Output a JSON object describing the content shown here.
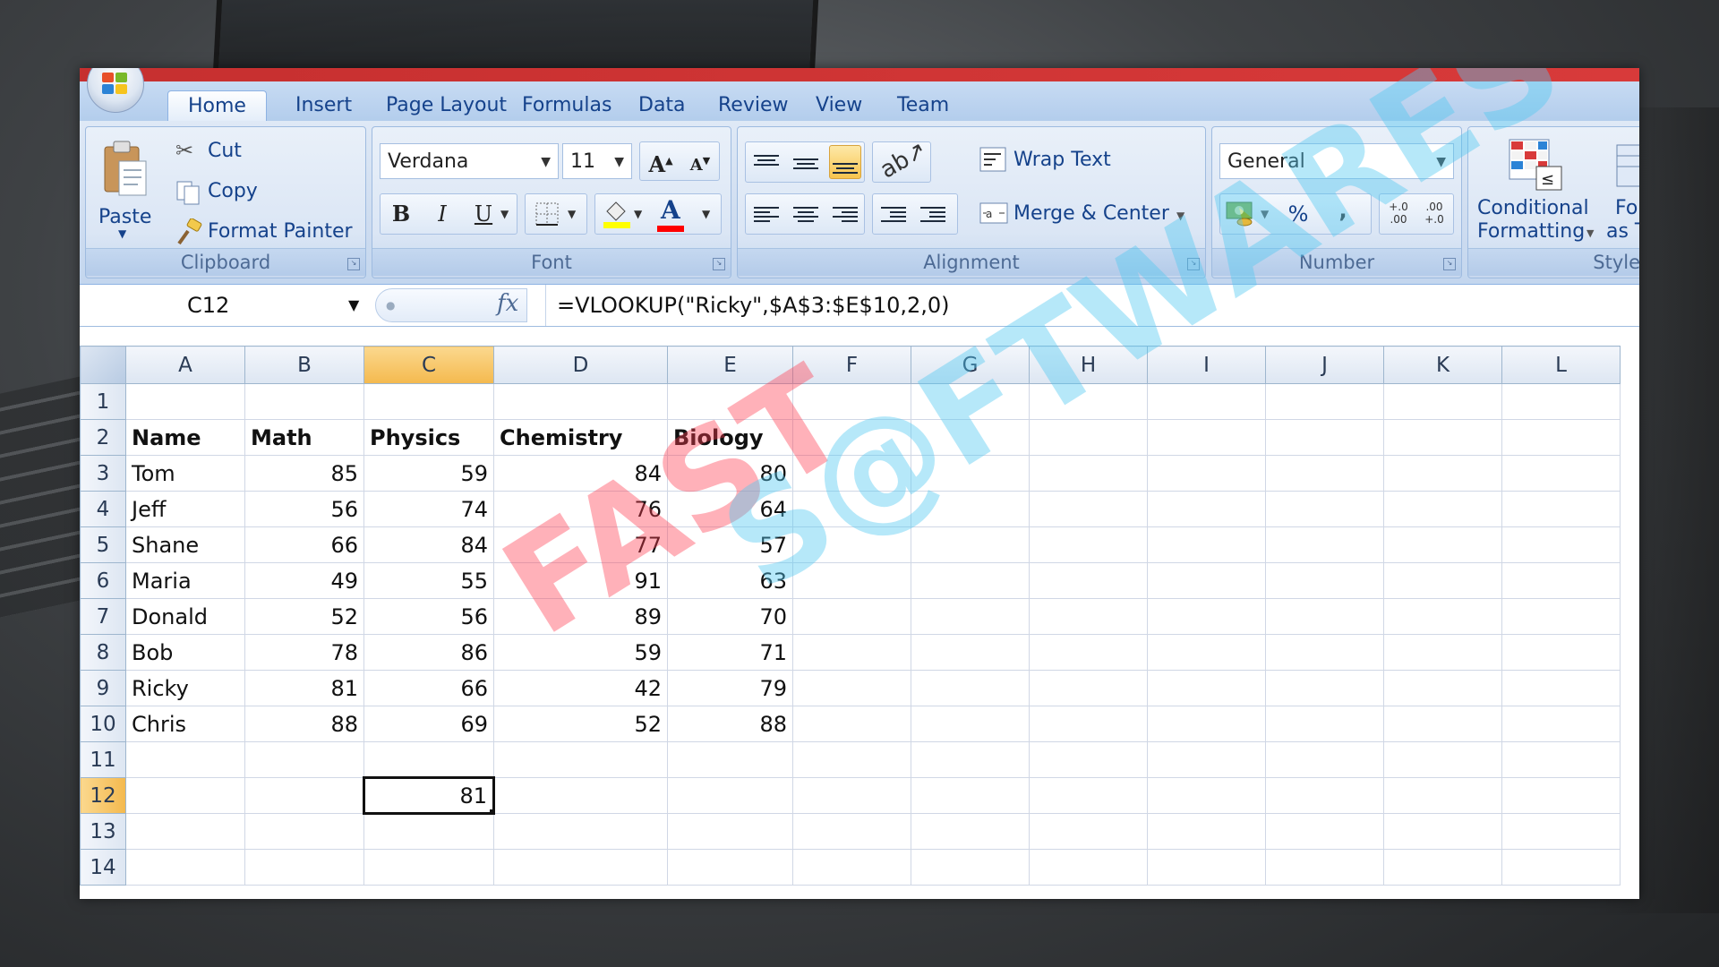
{
  "ribbon_tabs": [
    "Home",
    "Insert",
    "Page Layout",
    "Formulas",
    "Data",
    "Review",
    "View",
    "Team"
  ],
  "clipboard": {
    "paste": "Paste",
    "cut": "Cut",
    "copy": "Copy",
    "format_painter": "Format Painter",
    "label": "Clipboard"
  },
  "font": {
    "name": "Verdana",
    "size": "11",
    "bold": "B",
    "italic": "I",
    "underline": "U",
    "grow": "A",
    "shrink": "A",
    "color_letter": "A",
    "label": "Font",
    "fill_color": "#ffff00",
    "font_color": "#ff0000"
  },
  "alignment": {
    "wrap_text": "Wrap Text",
    "merge_center": "Merge & Center",
    "label": "Alignment"
  },
  "number": {
    "format": "General",
    "percent": "%",
    "comma": ",",
    "inc_decimal": "+.0 .00",
    "dec_decimal": ".00 +.0",
    "label": "Number"
  },
  "styles": {
    "conditional_line1": "Conditional",
    "conditional_line2": "Formatting",
    "format_table_line1": "Fo",
    "format_table_line2": "as T",
    "label": "Style"
  },
  "formula_bar": {
    "name_box": "C12",
    "fx": "fx",
    "formula": "=VLOOKUP(\"Ricky\",$A$3:$E$10,2,0)"
  },
  "columns": [
    "A",
    "B",
    "C",
    "D",
    "E",
    "F",
    "G",
    "H",
    "I",
    "J",
    "K",
    "L"
  ],
  "selected_column": "C",
  "rows": [
    "1",
    "2",
    "3",
    "4",
    "5",
    "6",
    "7",
    "8",
    "9",
    "10",
    "11",
    "12",
    "13",
    "14"
  ],
  "selected_row": "12",
  "headers": [
    "Name",
    "Math",
    "Physics",
    "Chemistry",
    "Biology"
  ],
  "data_rows": [
    {
      "name": "Tom",
      "math": "85",
      "physics": "59",
      "chemistry": "84",
      "biology": "80"
    },
    {
      "name": "Jeff",
      "math": "56",
      "physics": "74",
      "chemistry": "76",
      "biology": "64"
    },
    {
      "name": "Shane",
      "math": "66",
      "physics": "84",
      "chemistry": "77",
      "biology": "57"
    },
    {
      "name": "Maria",
      "math": "49",
      "physics": "55",
      "chemistry": "91",
      "biology": "63"
    },
    {
      "name": "Donald",
      "math": "52",
      "physics": "56",
      "chemistry": "89",
      "biology": "70"
    },
    {
      "name": "Bob",
      "math": "78",
      "physics": "86",
      "chemistry": "59",
      "biology": "71"
    },
    {
      "name": "Ricky",
      "math": "81",
      "physics": "66",
      "chemistry": "42",
      "biology": "79"
    },
    {
      "name": "Chris",
      "math": "88",
      "physics": "69",
      "chemistry": "52",
      "biology": "88"
    }
  ],
  "result_cell": {
    "ref": "C12",
    "value": "81"
  },
  "watermark": {
    "part1": "FAST",
    "part2": "S@FTWARES"
  }
}
